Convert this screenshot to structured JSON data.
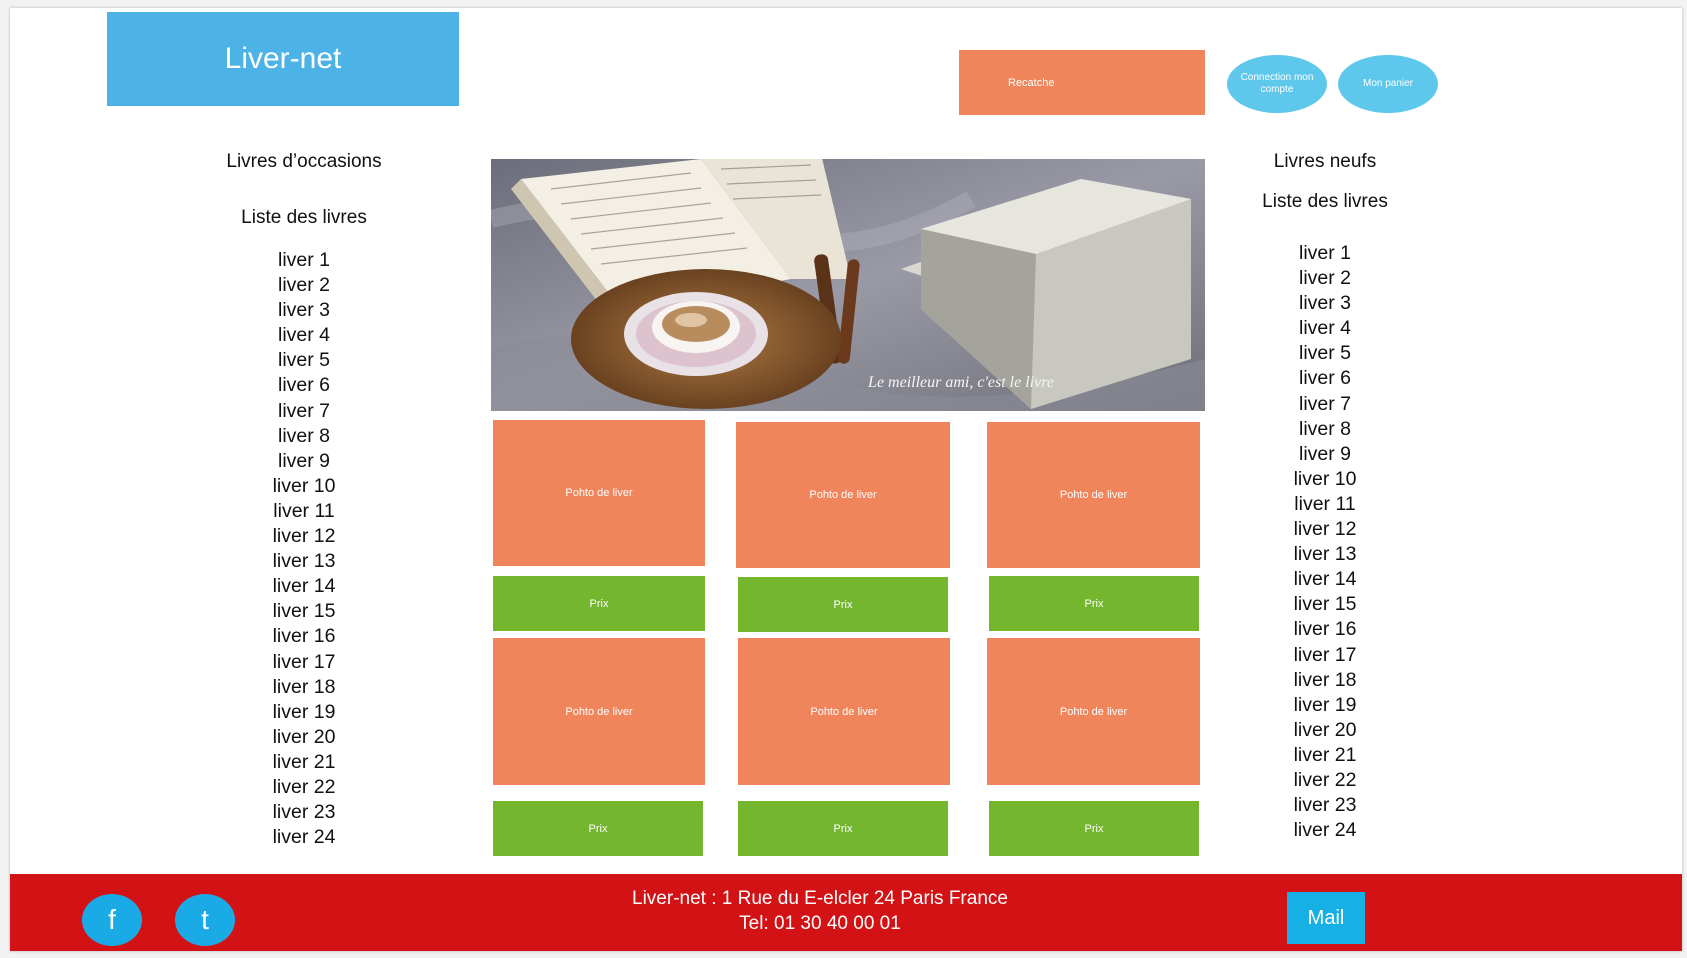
{
  "header": {
    "logo": "Liver-net",
    "search_label": "Recatche",
    "account_label": "Connection mon compte",
    "cart_label": "Mon panier"
  },
  "left": {
    "category": "Livres d’occasions",
    "list_title": "Liste des livres",
    "books": [
      "liver 1",
      "liver 2",
      "liver 3",
      "liver 4",
      "liver 5",
      "liver 6",
      "liver 7",
      "liver 8",
      "liver 9",
      "liver 10",
      "liver 11",
      "liver 12",
      "liver 13",
      "liver 14",
      "liver 15",
      "liver 16",
      "liver 17",
      "liver 18",
      "liver 19",
      "liver 20",
      "liver 21",
      "liver 22",
      "liver 23",
      "liver 24"
    ]
  },
  "right": {
    "category": "Livres neufs",
    "list_title": "Liste des livres",
    "books": [
      "liver 1",
      "liver 2",
      "liver 3",
      "liver 4",
      "liver 5",
      "liver 6",
      "liver 7",
      "liver 8",
      "liver 9",
      "liver 10",
      "liver 11",
      "liver 12",
      "liver 13",
      "liver 14",
      "liver 15",
      "liver 16",
      "liver 17",
      "liver 18",
      "liver 19",
      "liver 20",
      "liver 21",
      "liver 22",
      "liver 23",
      "liver 24"
    ]
  },
  "hero": {
    "caption": "Le meilleur ami, c'est le livre"
  },
  "cards": [
    {
      "photo": "Pohto de liver",
      "price": "Prix"
    },
    {
      "photo": "Pohto de liver",
      "price": "Prix"
    },
    {
      "photo": "Pohto de liver",
      "price": "Prix"
    },
    {
      "photo": "Pohto de liver",
      "price": "Prix"
    },
    {
      "photo": "Pohto de liver",
      "price": "Prix"
    },
    {
      "photo": "Pohto de liver",
      "price": "Prix"
    }
  ],
  "footer": {
    "facebook": "f",
    "twitter": "t",
    "address": "Liver-net : 1 Rue du E-elcler 24 Paris France",
    "phone": "Tel: 01 30 40 00 01",
    "mail_label": "Mail"
  },
  "colors": {
    "logo": "#4db2e6",
    "search": "#f0845a",
    "buttons": "#5ec8ec",
    "photo_card": "#f0845a",
    "price_card": "#74b72e",
    "footer": "#d31216",
    "mail": "#16b0e4"
  },
  "icons": {
    "facebook": "facebook-icon",
    "twitter": "twitter-icon"
  }
}
